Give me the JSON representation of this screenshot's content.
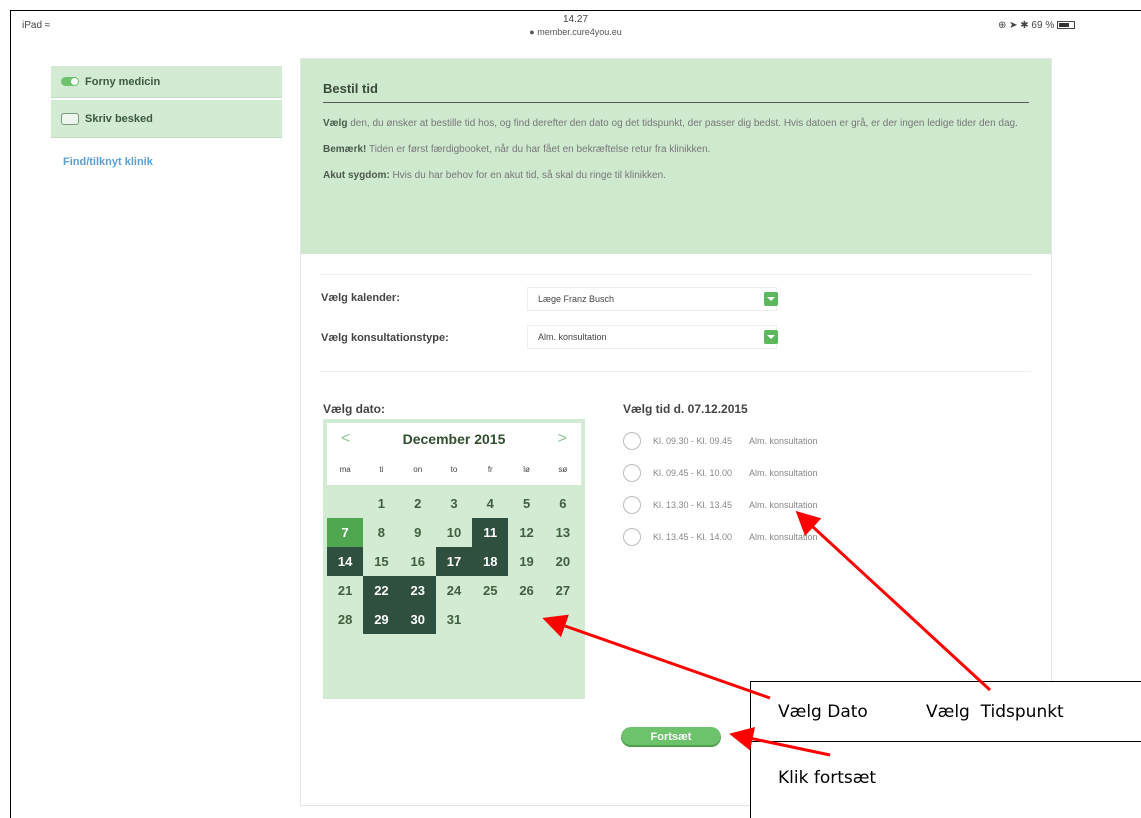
{
  "statusbar": {
    "device": "iPad",
    "time": "14.27",
    "url": "member.cure4you.eu",
    "battery": "69 %"
  },
  "sidebar": {
    "items": [
      {
        "label": "Forny medicin",
        "icon": "toggle-icon"
      },
      {
        "label": "Skriv besked",
        "icon": "message-icon"
      }
    ],
    "link": "Find/tilknyt klinik"
  },
  "info": {
    "title": "Bestil tid",
    "p1_bold": "Vælg",
    "p1": " den, du ønsker at bestille tid hos, og find derefter den dato og det tidspunkt, der passer dig bedst. Hvis datoen er grå, er der ingen ledige tider den dag.",
    "p2_bold": "Bemærk!",
    "p2": " Tiden er først færdigbooket, når du har fået en bekræftelse retur fra klinikken.",
    "p3_bold": "Akut sygdom:",
    "p3": " Hvis du har behov for en akut tid, så skal du ringe til klinikken."
  },
  "form": {
    "calendar_label": "Vælg kalender:",
    "calendar_value": "Læge Franz Busch",
    "type_label": "Vælg konsultationstype:",
    "type_value": "Alm. konsultation"
  },
  "date_section": {
    "label": "Vælg dato:",
    "month": "December 2015",
    "prev": "<",
    "next": ">",
    "weekdays": [
      "ma",
      "ti",
      "on",
      "to",
      "fr",
      "lø",
      "sø"
    ],
    "days": [
      "",
      "1",
      "2",
      "3",
      "4",
      "5",
      "6",
      "7",
      "8",
      "9",
      "10",
      "11",
      "12",
      "13",
      "14",
      "15",
      "16",
      "17",
      "18",
      "19",
      "20",
      "21",
      "22",
      "23",
      "24",
      "25",
      "26",
      "27",
      "28",
      "29",
      "30",
      "31"
    ],
    "highlighted_days": [
      "11",
      "14",
      "17",
      "18",
      "22",
      "23",
      "29",
      "30"
    ],
    "selected_day": "7"
  },
  "time_section": {
    "label": "Vælg tid d. 07.12.2015",
    "slots": [
      {
        "time": "Kl. 09.30 - Kl. 09.45",
        "type": "Alm. konsultation"
      },
      {
        "time": "Kl. 09.45 - Kl. 10.00",
        "type": "Alm. konsultation"
      },
      {
        "time": "Kl. 13.30 - Kl. 13.45",
        "type": "Alm. konsultation"
      },
      {
        "time": "Kl. 13.45 - Kl. 14.00",
        "type": "Alm. konsultation"
      }
    ]
  },
  "continue_label": "Fortsæt",
  "annotations": {
    "date": "Vælg Dato",
    "time": "Vælg  Tidspunkt",
    "continue": "Klik fortsæt"
  },
  "colors": {
    "panel_green": "#cfe9cf",
    "day_dark": "#2f4f3f",
    "day_selected": "#4fa84f",
    "button_green": "#6cc36c",
    "link_blue": "#5a9fd4",
    "arrow_red": "#ff0000"
  }
}
